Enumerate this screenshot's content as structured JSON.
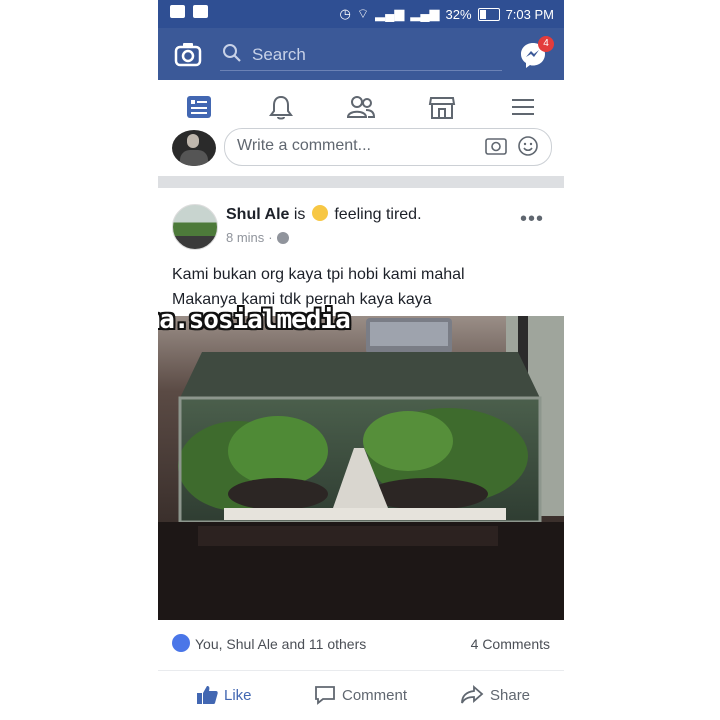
{
  "status_bar": {
    "battery": "32%",
    "time": "7:03 PM"
  },
  "header": {
    "search_placeholder": "Search",
    "messenger_badge": "4"
  },
  "nav": {
    "tabs": [
      "news-feed",
      "notifications",
      "friends",
      "marketplace",
      "menu"
    ]
  },
  "comment_box": {
    "placeholder": "Write a comment..."
  },
  "post": {
    "author": "Shul Ale",
    "activity_prefix": "is",
    "activity": "feeling tired.",
    "time": "8 mins",
    "text_line1": "Kami bukan org kaya tpi hobi kami mahal",
    "text_line2": "Makanya kami tdk pernah kaya kaya",
    "watermark": "@drama.sosialmedia",
    "likers": "You, Shul Ale and 11 others",
    "comments_count": "4 Comments",
    "actions": {
      "like": "Like",
      "comment": "Comment",
      "share": "Share"
    }
  },
  "colors": {
    "header_blue": "#3b5998",
    "status_blue": "#2f4f93",
    "like_blue": "#4267b2"
  }
}
